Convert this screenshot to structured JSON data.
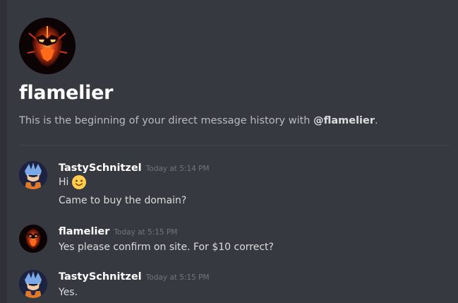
{
  "dm_header": {
    "title": "flamelier",
    "intro_prefix": "This is the beginning of your direct message history with ",
    "intro_mention": "@flamelier",
    "intro_suffix": "."
  },
  "messages": [
    {
      "author": "TastySchnitzel",
      "timestamp": "Today at 5:14 PM",
      "lines": [
        {
          "text": "Hi",
          "emoji": "slightly-smiling-face"
        },
        {
          "text": "Came to buy the domain?"
        }
      ]
    },
    {
      "author": "flamelier",
      "timestamp": "Today at 5:15 PM",
      "lines": [
        {
          "text": "Yes please confirm on site. For $10 correct?"
        }
      ]
    },
    {
      "author": "TastySchnitzel",
      "timestamp": "Today at 5:15 PM",
      "lines": [
        {
          "text": "Yes."
        }
      ]
    }
  ],
  "colors": {
    "background": "#36393f",
    "username": "#ffffff",
    "message_text": "#dcddde",
    "timestamp": "#72767d",
    "divider": "#42454a"
  }
}
